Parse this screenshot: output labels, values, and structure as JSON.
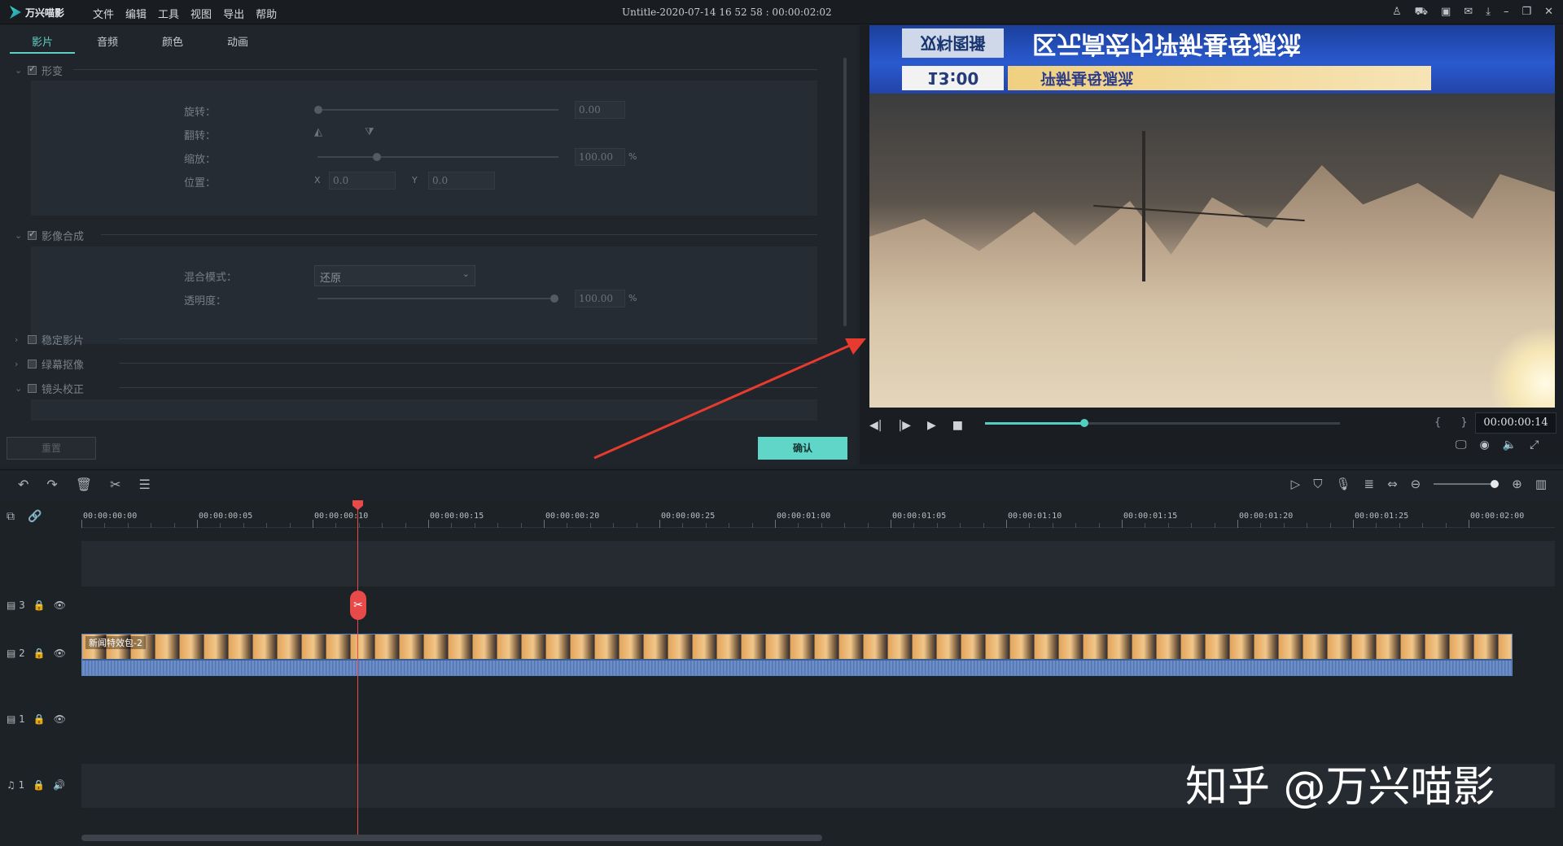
{
  "app": {
    "logo_text": "万兴喵影",
    "menu": [
      "文件",
      "编辑",
      "工具",
      "视图",
      "导出",
      "帮助"
    ],
    "doc_title": "Untitle-2020-07-14 16 52 58 : 00:00:02:02",
    "window_icons": [
      "user-icon",
      "cart-icon",
      "save-icon",
      "mail-icon",
      "download-icon",
      "minimize-icon",
      "restore-icon",
      "close-icon"
    ]
  },
  "editor": {
    "tabs": [
      "影片",
      "音频",
      "颜色",
      "动画"
    ],
    "active_tab": "影片",
    "transform": {
      "title": "形变",
      "rotate_label": "旋转：",
      "rotate_value": "0.00",
      "flip_label": "翻转：",
      "scale_label": "缩放：",
      "scale_value": "100.00",
      "scale_unit": "%",
      "position_label": "位置：",
      "x_label": "X",
      "x_value": "0.0",
      "y_label": "Y",
      "y_value": "0.0"
    },
    "composite": {
      "title": "影像合成",
      "blend_label": "混合模式：",
      "blend_value": "还原",
      "opacity_label": "透明度：",
      "opacity_value": "100.00",
      "opacity_unit": "%"
    },
    "stabilize": "稳定影片",
    "chroma": "绿幕抠像",
    "lens": "镜头校正",
    "reset_label": "重置",
    "ok_label": "确认"
  },
  "preview": {
    "ticker_badge": "双料图播",
    "ticker_main": "区元高宏内评新基母源流",
    "ticker_time": "13:00",
    "ticker_sub": "评新基母源流",
    "timecode": "00:00:00:14",
    "progress": 0.28
  },
  "timeline": {
    "ruler_labels": [
      "00:00:00:00",
      "00:00:00:05",
      "00:00:00:10",
      "00:00:00:15",
      "00:00:00:20",
      "00:00:00:25",
      "00:00:01:00",
      "00:00:01:05",
      "00:00:01:10",
      "00:00:01:15",
      "00:00:01:20",
      "00:00:01:25",
      "00:00:02:00"
    ],
    "tracks": [
      {
        "name": "3",
        "kind": "video"
      },
      {
        "name": "2",
        "kind": "video"
      },
      {
        "name": "1",
        "kind": "video"
      },
      {
        "name": "1",
        "kind": "audio"
      }
    ],
    "clip_title": "新闻特效包-2"
  },
  "watermark": "知乎 @万兴喵影"
}
